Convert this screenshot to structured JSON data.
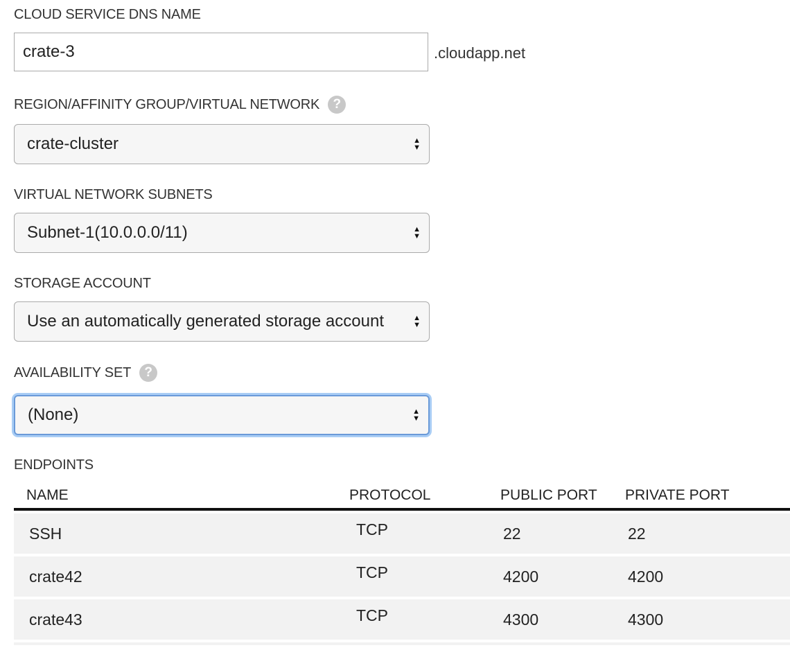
{
  "dns": {
    "label": "CLOUD SERVICE DNS NAME",
    "value": "crate-3",
    "suffix": ".cloudapp.net"
  },
  "region": {
    "label": "REGION/AFFINITY GROUP/VIRTUAL NETWORK",
    "value": "crate-cluster"
  },
  "subnets": {
    "label": "VIRTUAL NETWORK SUBNETS",
    "value": "Subnet-1(10.0.0.0/11)"
  },
  "storage": {
    "label": "STORAGE ACCOUNT",
    "value": "Use an automatically generated storage account"
  },
  "availability": {
    "label": "AVAILABILITY SET",
    "value": "(None)"
  },
  "help_glyph": "?",
  "endpoints": {
    "label": "ENDPOINTS",
    "columns": [
      "NAME",
      "PROTOCOL",
      "PUBLIC PORT",
      "PRIVATE PORT"
    ],
    "rows": [
      [
        "SSH",
        "TCP",
        "22",
        "22"
      ],
      [
        "crate42",
        "TCP",
        "4200",
        "4200"
      ],
      [
        "crate43",
        "TCP",
        "4300",
        "4300"
      ]
    ]
  }
}
